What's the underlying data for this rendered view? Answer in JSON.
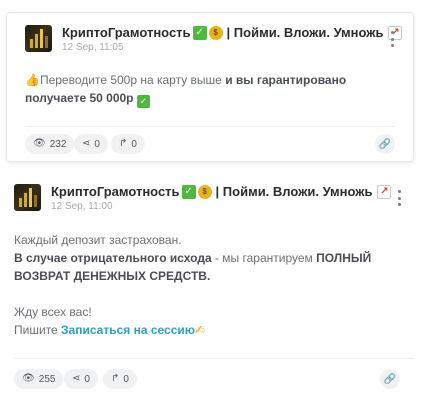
{
  "posts": [
    {
      "channel_name": "КриптоГрамотность",
      "channel_suffix": "| Пойми. Вложи. Умножь",
      "date": "12 Sep, 11:05",
      "body": {
        "emoji_prefix": "👍",
        "text_plain": "Переводите 500р на карту выше ",
        "text_bold": "и вы гарантировано получаете 50 000р"
      },
      "stats": {
        "views": "232",
        "shares": "0",
        "forwards": "0"
      }
    },
    {
      "channel_name": "КриптоГрамотность",
      "channel_suffix": "| Пойми. Вложи. Умножь",
      "date": "12 Sep, 11:00",
      "body": {
        "line1": "Каждый депозит застрахован.",
        "line2_bold_a": "В случае отрицательного исхода",
        "line2_plain": " - мы гарантируем ",
        "line2_bold_b": "ПОЛНЫЙ",
        "line3_bold": "ВОЗВРАТ ДЕНЕЖНЫХ СРЕДСТВ.",
        "line4": "Жду всех вас!",
        "line5_prefix": "Пишите ",
        "line5_link": "Записаться на сессию",
        "line5_emoji": "✍"
      },
      "stats": {
        "views": "255",
        "shares": "0",
        "forwards": "0"
      }
    }
  ],
  "icons": {
    "views": "eye-icon",
    "share": "share-icon",
    "forward": "forward-icon",
    "link": "link-icon",
    "menu": "more-vertical-icon"
  }
}
